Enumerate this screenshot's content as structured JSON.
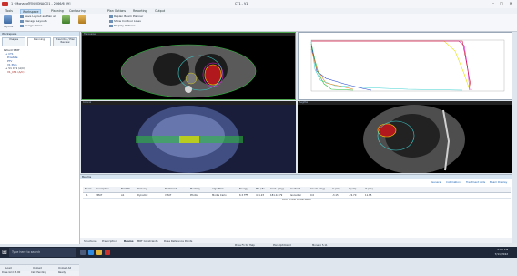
{
  "window": {
    "title": "1 · Monaco@[NMONACO1 - 2066/6 09]",
    "doc": "CT1 - V1"
  },
  "menubar": {
    "items": [
      "Tools",
      "Workspace",
      "Planning",
      "Contouring",
      "Plan Options",
      "Reporting",
      "Output"
    ]
  },
  "ribbon": {
    "items": [
      "Save Layout as Plan all",
      "Manage Layouts",
      "Assign Views",
      "Show Contoured",
      "Contour Overlays",
      "Structure Sets"
    ],
    "small": [
      "Layouts",
      "Reset",
      "Display"
    ],
    "right": [
      "Replan Beam Planner",
      "Show Contour Lines",
      "Display Options"
    ]
  },
  "left": {
    "header": "Workspace",
    "tabs": [
      "Images",
      "Planning",
      "Prescribe / Plan Review"
    ],
    "tree": [
      "Patient SBRT",
      "+ CT1",
      "  Prostate",
      "  PTV",
      "  V1 Plan",
      "+ V1 CT1 (A/C)",
      "  V1_CT1 (A/C)"
    ],
    "footer": [
      "Load",
      "Unload",
      "Unload All"
    ],
    "status": [
      "Dose Grid: 3.00",
      "Calc Pending",
      "Ready"
    ]
  },
  "views": {
    "axial": "Transverse",
    "dvh": "Dose Volume Histogram",
    "coronal": "Coronal",
    "sagittal": "Sagittal"
  },
  "bottom": {
    "header": "Beams",
    "subtabs": [
      "General",
      "Collimation",
      "Treatment Aids",
      "Beam Display"
    ],
    "columns": [
      "Beam",
      "Description",
      "Field ID",
      "Delivery",
      "Treatment...",
      "Modality",
      "Algorithm",
      "Energy",
      "MU / Fx",
      "Gant. (deg)",
      "Iso Point",
      "Couch (deg)",
      "X (cm)",
      "Y (cm)",
      "Z (cm)"
    ],
    "row": [
      "1",
      "VMAT",
      "A1",
      "Dynamic",
      "VMAT",
      "Photon",
      "Monte Carlo",
      "6 X FFF",
      "431.23",
      "181.0-179",
      "Isocenter",
      "0.0",
      "-3.15",
      "-22.70",
      "11.85"
    ],
    "add_row": "Click to add a new Beam",
    "tabs": [
      "Structures",
      "Prescription",
      "Beams",
      "IMRT Constraints",
      "Dose Reference Points"
    ]
  },
  "status_bar": {
    "left": "Press F1 for Help",
    "middle": "Plan Optimized",
    "right": "Monaco 5.11"
  },
  "taskbar": {
    "search": "Type here to search",
    "time": "9:58 AM",
    "date": "7/11/2022"
  },
  "colors": {
    "accent": "#2b6cc4",
    "ptv": "#c8102e",
    "green": "#2bbd3a",
    "cyan": "#3fd2d2",
    "yellow": "#e8e000",
    "magenta": "#e01ad0"
  }
}
